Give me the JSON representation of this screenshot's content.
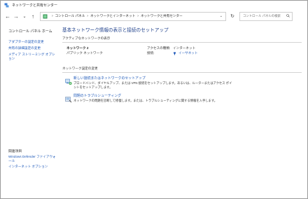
{
  "window": {
    "title": "ネットワークと共有センター"
  },
  "address": {
    "crumbs": [
      "コントロール パネル",
      "ネットワークとインターネット",
      "ネットワークと共有センター"
    ],
    "search_placeholder": "コントロール パネルの検索"
  },
  "sidebar": {
    "home": "コントロール パネル ホーム",
    "links": [
      "アダプターの設定の変更",
      "共有の詳細設定の変更",
      "メディア ストリーミング オプション"
    ],
    "see_also": "関連項目",
    "bottom_links": [
      "Windows Defender ファイアウォール",
      "インターネット オプション"
    ]
  },
  "main": {
    "title": "基本ネットワーク情報の表示と接続のセットアップ",
    "active_networks_label": "アクティブなネットワークの表示",
    "network": {
      "name": "ネットワーク 2",
      "type": "パブリック ネットワーク",
      "access_type_label": "アクセスの種類:",
      "access_type_value": "接続:",
      "connection_label": "インターネット",
      "connection_value": "イーサネット"
    },
    "change_label": "ネットワーク設定の変更",
    "tasks": [
      {
        "link": "新しい接続またはネットワークのセットアップ",
        "desc": "ブロードバンド、ダイヤルアップ、または VPN 接続をセットアップします。あるいは、ルーターまたはアクセス ポイントをセットアップします。"
      },
      {
        "link": "問題のトラブルシューティング",
        "desc": "ネットワークの問題を診断して修復します。または、トラブルシューティングに関する情報を入手します。"
      }
    ]
  }
}
